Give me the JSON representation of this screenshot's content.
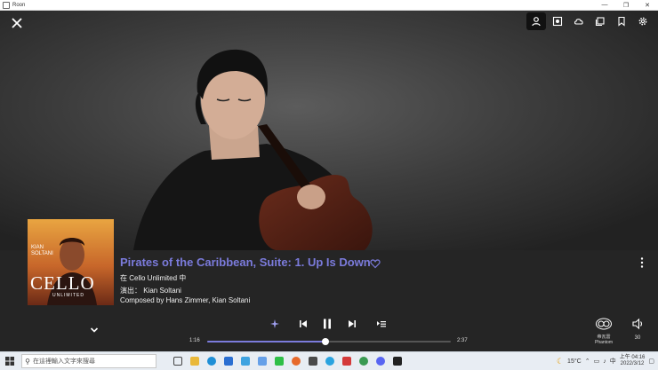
{
  "window": {
    "title": "Roon",
    "controls": [
      "—",
      "❐",
      "✕"
    ]
  },
  "top_bar": {
    "close_icon": "close-icon",
    "icons": [
      {
        "name": "artist-bio-icon",
        "active": true
      },
      {
        "name": "album-view-icon",
        "active": false
      },
      {
        "name": "cloud-lyrics-icon",
        "active": false
      },
      {
        "name": "queue-cloud-icon",
        "active": false
      },
      {
        "name": "bookmark-icon",
        "active": false
      },
      {
        "name": "settings-icon",
        "active": false
      }
    ]
  },
  "album_cover": {
    "artist_text": "KIAN SOLTANI",
    "title_text": "CELLO",
    "subtitle_text": "UNLIMITED"
  },
  "track": {
    "title": "Pirates of the Caribbean, Suite: 1. Up Is Down",
    "album_line": "在 Cello Unlimited 中",
    "artist_line": "演出： Kian Soltani",
    "composer_line": "Composed by Hans Zimmer, Kian Soltani"
  },
  "playback": {
    "current_time": "1:16",
    "total_time": "2:37",
    "progress": 0.484
  },
  "zone": {
    "label_line1": "帝瓦雷",
    "label_line2": "Phantom"
  },
  "volume": {
    "value": "30"
  },
  "taskbar": {
    "search_placeholder": "在這裡輸入文字來搜尋",
    "temperature": "15°C",
    "ime": "中",
    "clock_time": "上午 04:16",
    "clock_date": "2022/3/12"
  },
  "colors": {
    "accent": "#7b7bdc",
    "background": "#252525"
  }
}
